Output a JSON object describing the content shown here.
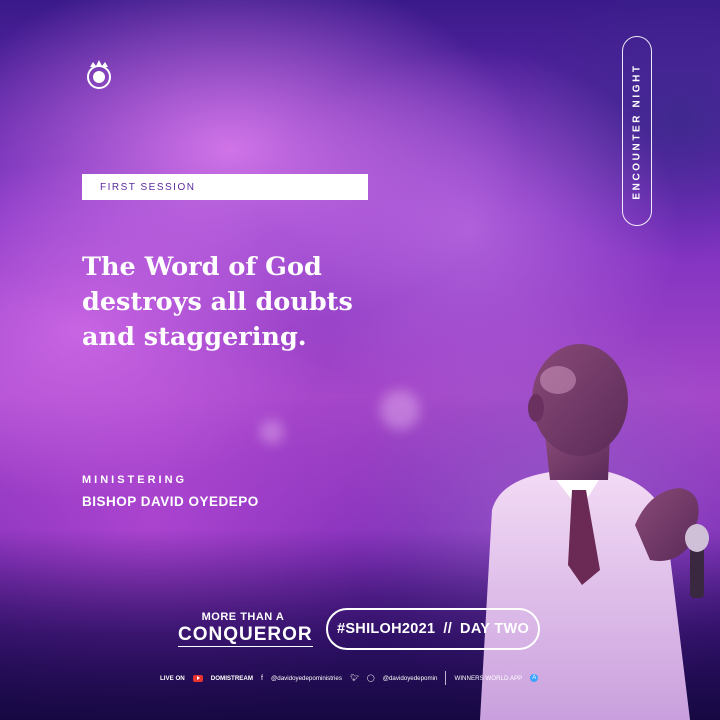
{
  "header": {
    "session_label": "FIRST SESSION",
    "encounter_label": "ENCOUNTER NIGHT"
  },
  "quote": {
    "line1": "The Word of God",
    "line2": "destroys all doubts",
    "line3": "and staggering."
  },
  "minister": {
    "label": "MINISTERING",
    "name": "BISHOP DAVID OYEDEPO"
  },
  "theme": {
    "small": "MORE THAN A",
    "big": "CONQUEROR"
  },
  "hashtag": {
    "tag": "#SHILOH2021",
    "divider": "//",
    "day": "DAY TWO"
  },
  "footer": {
    "live_on": "LIVE ON",
    "domistream": "DOMISTREAM",
    "facebook": "@davidoyedepoministries",
    "twitter_instagram": "@davidoyedepomin",
    "app": "WINNERS WORLD APP"
  },
  "colors": {
    "accent_purple": "#5a2aa0",
    "bg_deep": "#2a1068",
    "bg_mid": "#a547c9"
  },
  "icons": [
    "crown-logo-icon",
    "youtube-icon",
    "facebook-icon",
    "twitter-icon",
    "instagram-icon",
    "app-store-icon"
  ]
}
